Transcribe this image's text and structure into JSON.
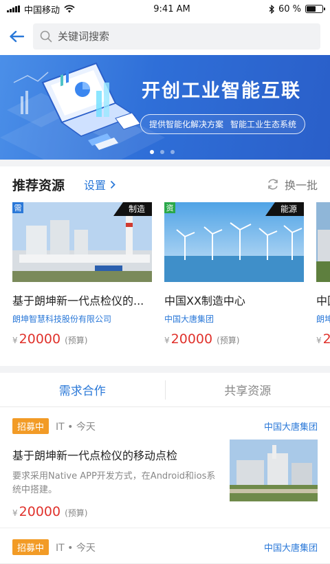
{
  "status": {
    "carrier": "中国移动",
    "time": "9:41 AM",
    "battery": "60 %",
    "battery_level": 0.6
  },
  "search": {
    "placeholder": "关键词搜索"
  },
  "banner": {
    "title": "开创工业智能互联",
    "sub1": "提供智能化解决方案",
    "sub2": "智能工业生态系统",
    "active_dot": 0
  },
  "recommend": {
    "title": "推荐资源",
    "settings_label": "设置",
    "refresh_label": "换一批",
    "cards": [
      {
        "tag": "需",
        "category": "制造",
        "title": "基于朗坤新一代点检仪的...",
        "company": "朗坤智慧科技股份有限公司",
        "yen": "¥",
        "price": "20000",
        "budget": "(预算)"
      },
      {
        "tag": "资",
        "category": "能源",
        "title": "中国XX制造中心",
        "company": "中国大唐集团",
        "yen": "¥",
        "price": "20000",
        "budget": "(预算)"
      },
      {
        "tag": "",
        "category": "",
        "title": "中国",
        "company": "朗坤",
        "yen": "¥",
        "price": "2",
        "budget": ""
      }
    ]
  },
  "tabs": [
    {
      "label": "需求合作"
    },
    {
      "label": "共享资源"
    }
  ],
  "demands": [
    {
      "status": "招募中",
      "meta": "IT • 今天",
      "company": "中国大唐集团",
      "title": "基于朗坤新一代点检仪的移动点检",
      "desc": "要求采用Native APP开发方式，在Android和ios系统中搭建。",
      "yen": "¥",
      "price": "20000",
      "budget": "(预算)"
    },
    {
      "status": "招募中",
      "meta": "IT • 今天",
      "company": "中国大唐集团",
      "title": "",
      "desc": "",
      "yen": "",
      "price": "",
      "budget": ""
    }
  ],
  "colors": {
    "accent": "#2a78d8",
    "price": "#e0322c",
    "badge": "#f29b26"
  }
}
